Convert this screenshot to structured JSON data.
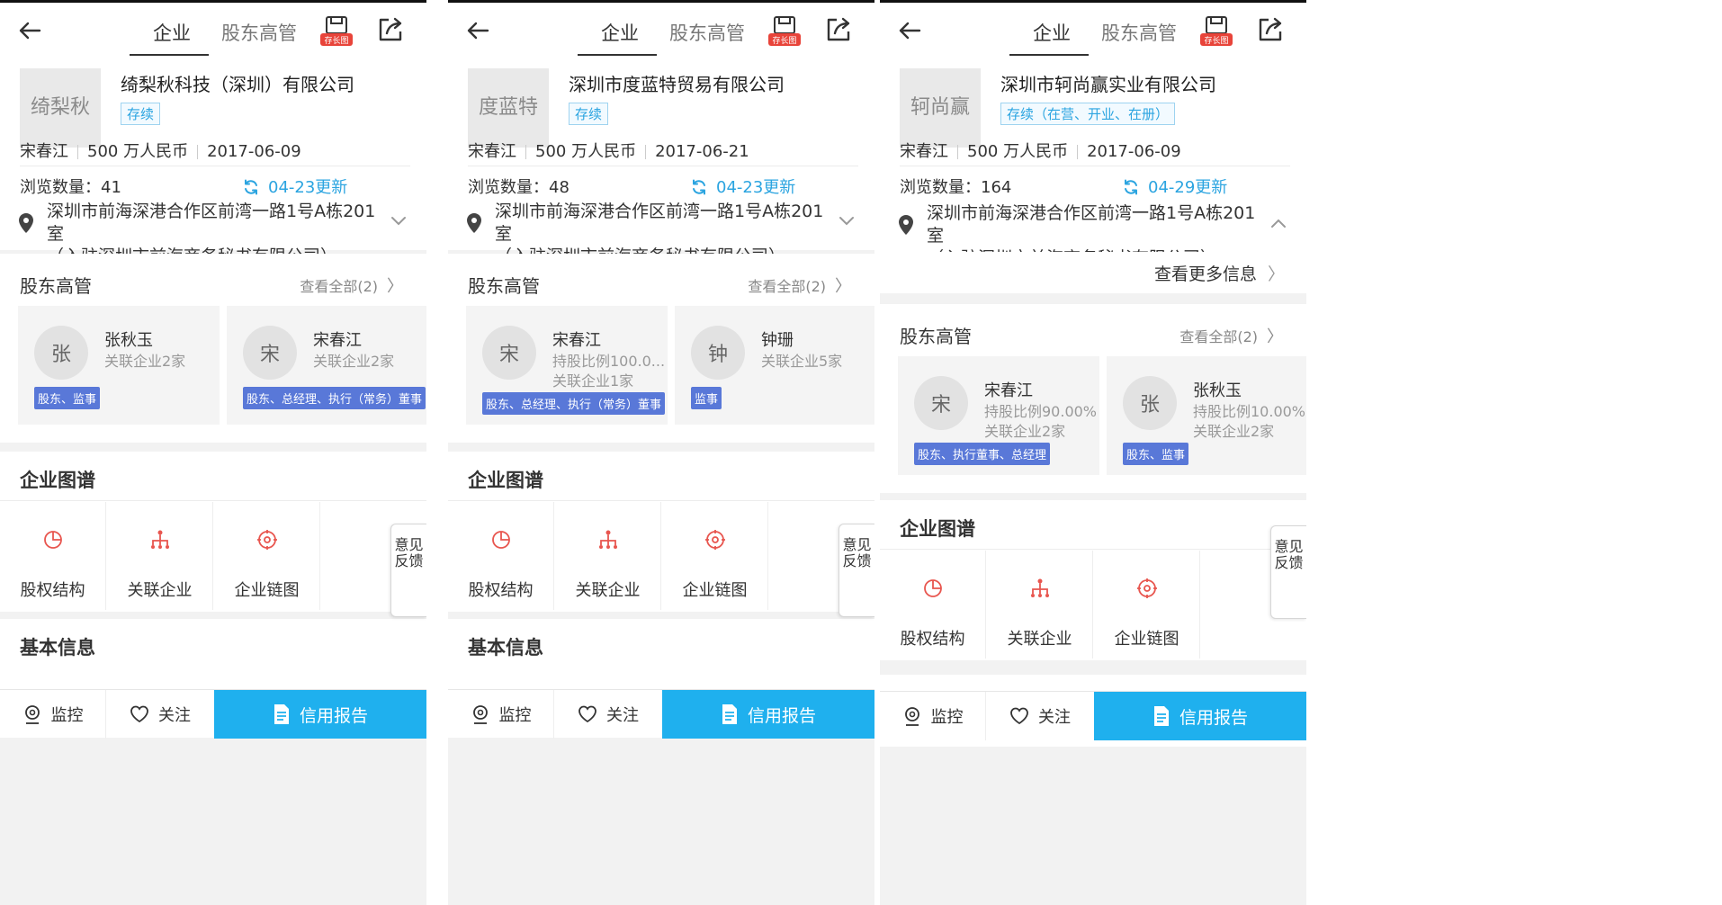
{
  "tabs": {
    "company": "企业",
    "shareholders": "股东高管"
  },
  "save_badge": "存长图",
  "panels": [
    {
      "logo_text": "绮梨秋",
      "company_name": "绮梨秋科技（深圳）有限公司",
      "status": "存续",
      "legal_person": "宋春江",
      "capital": "500 万人民币",
      "founded": "2017-06-09",
      "views_label": "浏览数量：41",
      "update_label": "04-23更新",
      "address_line1": "深圳市前海深港合作区前湾一路1号A栋201室",
      "address_line2": "（入驻深圳市前海商务秘书有限公司）",
      "more_info": "",
      "section_shareholders": "股东高管",
      "see_all": "查看全部(2)",
      "people": [
        {
          "avatar": "张",
          "name": "张秋玉",
          "line1": "关联企业2家",
          "line2": "",
          "role": "股东、监事"
        },
        {
          "avatar": "宋",
          "name": "宋春江",
          "line1": "关联企业2家",
          "line2": "",
          "role": "股东、总经理、执行（常务）董事"
        }
      ],
      "section_graph": "企业图谱",
      "graph_items": [
        "股权结构",
        "关联企业",
        "企业链图"
      ],
      "feedback": "意见反馈",
      "section_basic": "基本信息",
      "bottom": {
        "monitor": "监控",
        "follow": "关注",
        "report": "信用报告"
      }
    },
    {
      "logo_text": "度蓝特",
      "company_name": "深圳市度蓝特贸易有限公司",
      "status": "存续",
      "legal_person": "宋春江",
      "capital": "500 万人民币",
      "founded": "2017-06-21",
      "views_label": "浏览数量：48",
      "update_label": "04-23更新",
      "address_line1": "深圳市前海深港合作区前湾一路1号A栋201室",
      "address_line2": "（入驻深圳市前海商务秘书有限公司）",
      "more_info": "",
      "section_shareholders": "股东高管",
      "see_all": "查看全部(2)",
      "people": [
        {
          "avatar": "宋",
          "name": "宋春江",
          "line1": "持股比例100.0...",
          "line2": "关联企业1家",
          "role": "股东、总经理、执行（常务）董事"
        },
        {
          "avatar": "钟",
          "name": "钟珊",
          "line1": "关联企业5家",
          "line2": "",
          "role": "监事"
        }
      ],
      "section_graph": "企业图谱",
      "graph_items": [
        "股权结构",
        "关联企业",
        "企业链图"
      ],
      "feedback": "意见反馈",
      "section_basic": "基本信息",
      "bottom": {
        "monitor": "监控",
        "follow": "关注",
        "report": "信用报告"
      }
    },
    {
      "logo_text": "轲尚赢",
      "company_name": "深圳市轲尚赢实业有限公司",
      "status": "存续（在营、开业、在册）",
      "legal_person": "宋春江",
      "capital": "500 万人民币",
      "founded": "2017-06-09",
      "views_label": "浏览数量：164",
      "update_label": "04-29更新",
      "address_line1": "深圳市前海深港合作区前湾一路1号A栋201室",
      "address_line2": "（入驻深圳市前海商务秘书有限公司）",
      "more_info": "查看更多信息",
      "section_shareholders": "股东高管",
      "see_all": "查看全部(2)",
      "people": [
        {
          "avatar": "宋",
          "name": "宋春江",
          "line1": "持股比例90.00%",
          "line2": "关联企业2家",
          "role": "股东、执行董事、总经理"
        },
        {
          "avatar": "张",
          "name": "张秋玉",
          "line1": "持股比例10.00%",
          "line2": "关联企业2家",
          "role": "股东、监事"
        }
      ],
      "section_graph": "企业图谱",
      "graph_items": [
        "股权结构",
        "关联企业",
        "企业链图"
      ],
      "feedback": "意见反馈",
      "section_basic": "基本信息",
      "bottom": {
        "monitor": "监控",
        "follow": "关注",
        "report": "信用报告"
      }
    }
  ],
  "colors": {
    "accent": "#1fb0ee",
    "role_badge": "#5978d8",
    "graph_icon": "#e8564f",
    "status_text": "#2ba4e0"
  }
}
